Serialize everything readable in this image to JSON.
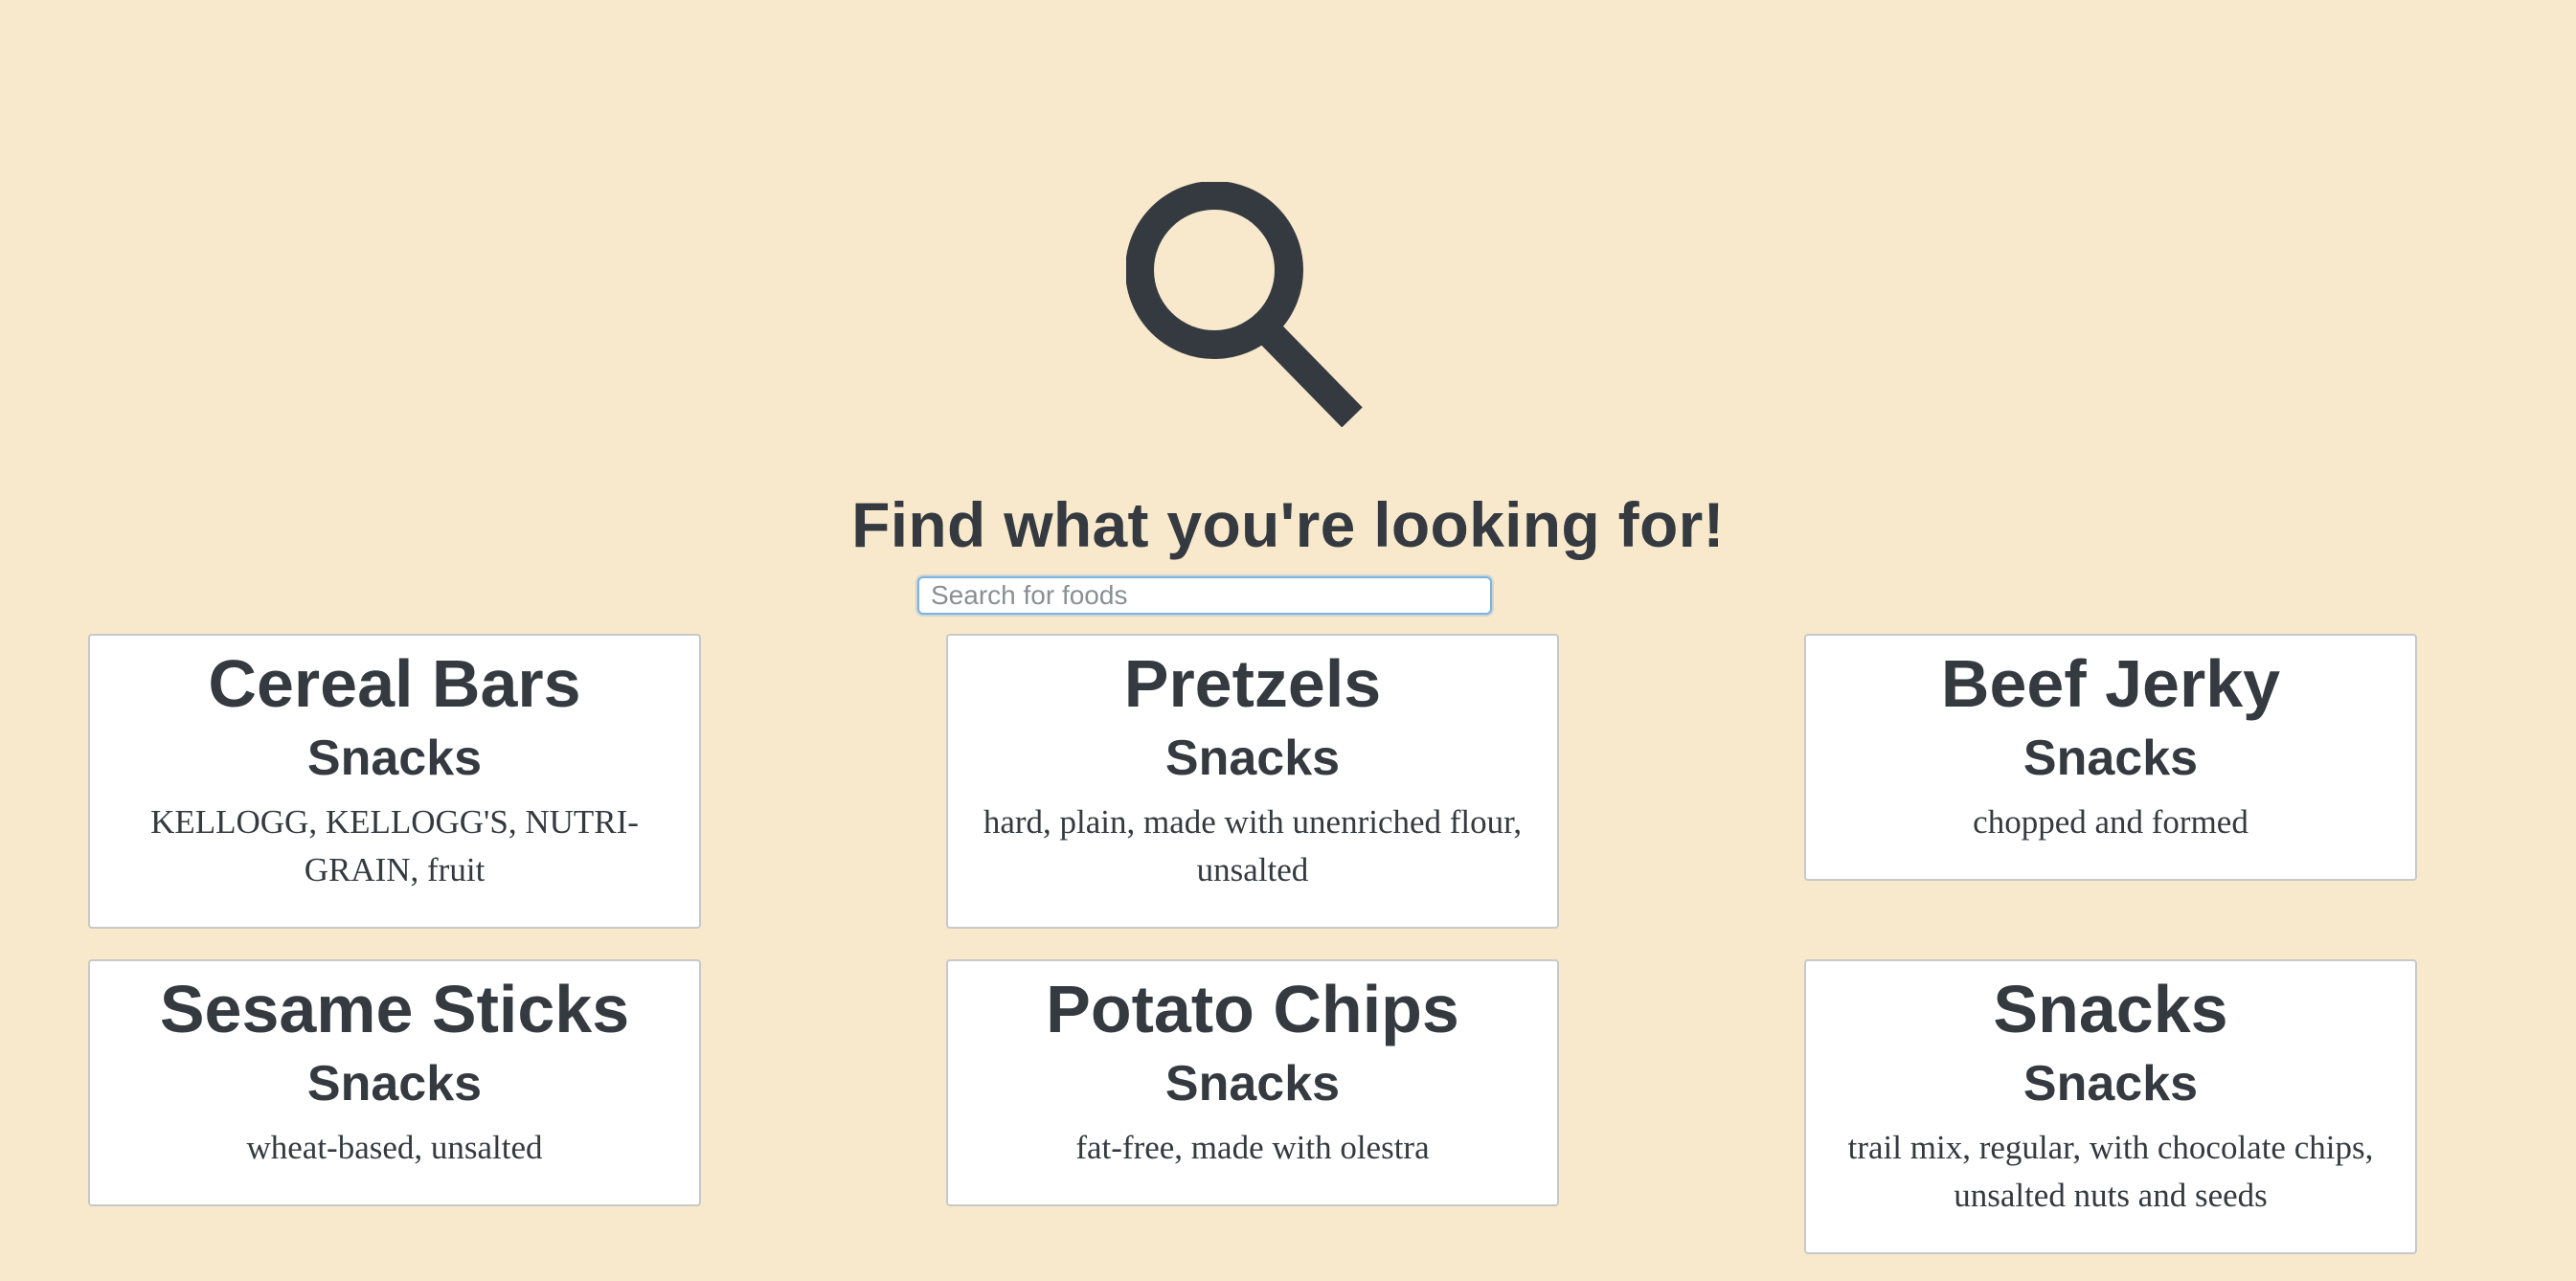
{
  "hero": {
    "icon": "search-icon",
    "icon_color": "#343a40",
    "title": "Find what you're looking for!"
  },
  "search": {
    "placeholder": "Search for foods",
    "value": ""
  },
  "colors": {
    "background": "#f8e9cd",
    "text": "#343a40",
    "card_background": "#ffffff",
    "input_focus_border": "#7fb3df"
  },
  "results": [
    {
      "title": "Cereal Bars",
      "category": "Snacks",
      "description": "KELLOGG, KELLOGG'S, NUTRI-GRAIN, fruit"
    },
    {
      "title": "Pretzels",
      "category": "Snacks",
      "description": "hard, plain, made with unenriched flour, unsalted"
    },
    {
      "title": "Beef Jerky",
      "category": "Snacks",
      "description": "chopped and formed"
    },
    {
      "title": "Sesame Sticks",
      "category": "Snacks",
      "description": "wheat-based, unsalted"
    },
    {
      "title": "Potato Chips",
      "category": "Snacks",
      "description": "fat-free, made with olestra"
    },
    {
      "title": "Snacks",
      "category": "Snacks",
      "description": "trail mix, regular, with chocolate chips, unsalted nuts and seeds"
    }
  ]
}
